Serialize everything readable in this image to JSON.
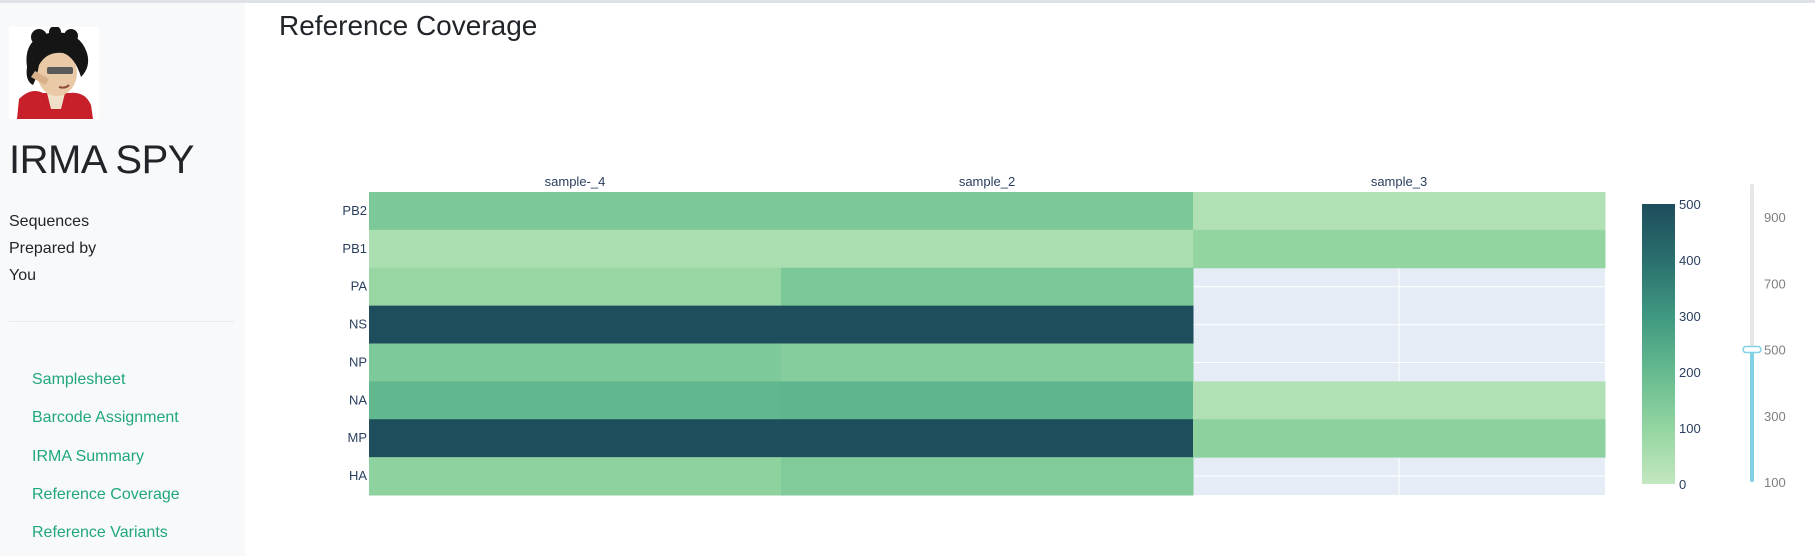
{
  "sidebar": {
    "app_title": "IRMA SPY",
    "subtitle_lines": [
      "Sequences",
      "Prepared by",
      "You"
    ],
    "nav": [
      {
        "label": "Samplesheet"
      },
      {
        "label": "Barcode Assignment"
      },
      {
        "label": "IRMA Summary"
      },
      {
        "label": "Reference Coverage"
      },
      {
        "label": "Reference Variants"
      }
    ]
  },
  "main": {
    "title": "Reference Coverage"
  },
  "colors": {
    "link": "#20a77e",
    "heat_low": "#c3e7c0",
    "heat_high": "#1e4d5c",
    "empty_cell": "#e5ecf6",
    "slider_track_active": "#7fd1e4"
  },
  "chart_data": {
    "type": "heatmap",
    "title": "",
    "x_categories": [
      "sample-_4",
      "sample_2",
      "sample_3"
    ],
    "y_categories": [
      "PB2",
      "PB1",
      "PA",
      "NS",
      "NP",
      "NA",
      "MP",
      "HA"
    ],
    "cells": [
      {
        "x": "sample-_4",
        "y": "PB2",
        "value": 150
      },
      {
        "x": "sample_2",
        "y": "PB2",
        "value": 150
      },
      {
        "x": "sample_3",
        "y": "PB2",
        "value": 40
      },
      {
        "x": "sample-_4",
        "y": "PB1",
        "value": 50
      },
      {
        "x": "sample_2",
        "y": "PB1",
        "value": 50
      },
      {
        "x": "sample_3",
        "y": "PB1",
        "value": 100
      },
      {
        "x": "sample-_4",
        "y": "PA",
        "value": 90
      },
      {
        "x": "sample_2",
        "y": "PA",
        "value": 150
      },
      {
        "x": "sample_3",
        "y": "PA",
        "value": null
      },
      {
        "x": "sample-_4",
        "y": "NS",
        "value": 500
      },
      {
        "x": "sample_2",
        "y": "NS",
        "value": 500
      },
      {
        "x": "sample_3",
        "y": "NS",
        "value": null
      },
      {
        "x": "sample-_4",
        "y": "NP",
        "value": 145
      },
      {
        "x": "sample_2",
        "y": "NP",
        "value": 130
      },
      {
        "x": "sample_3",
        "y": "NP",
        "value": null
      },
      {
        "x": "sample-_4",
        "y": "NA",
        "value": 210
      },
      {
        "x": "sample_2",
        "y": "NA",
        "value": 215
      },
      {
        "x": "sample_3",
        "y": "NA",
        "value": 40
      },
      {
        "x": "sample-_4",
        "y": "MP",
        "value": 500
      },
      {
        "x": "sample_2",
        "y": "MP",
        "value": 500
      },
      {
        "x": "sample_3",
        "y": "MP",
        "value": 115
      },
      {
        "x": "sample-_4",
        "y": "HA",
        "value": 110
      },
      {
        "x": "sample_2",
        "y": "HA",
        "value": 140
      },
      {
        "x": "sample_3",
        "y": "HA",
        "value": null
      }
    ],
    "colorbar": {
      "ticks": [
        0,
        100,
        200,
        300,
        400,
        500
      ],
      "range": [
        0,
        500
      ]
    },
    "slider": {
      "ticks": [
        100,
        300,
        500,
        700,
        900
      ],
      "range": [
        100,
        1000
      ],
      "value": 500
    }
  }
}
